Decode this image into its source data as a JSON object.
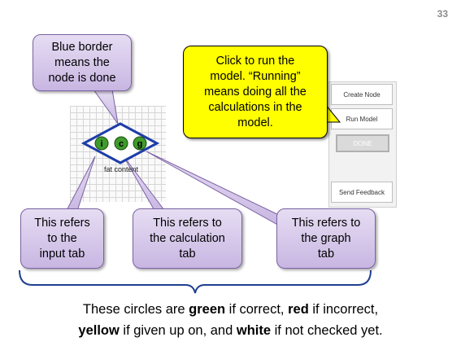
{
  "slide_number": "33",
  "node": {
    "label": "fat content",
    "badges": [
      "i",
      "c",
      "g"
    ],
    "border_color": "#1e3da8",
    "badge_color": "#3f9b2c"
  },
  "side_panel": {
    "create_node": "Create Node",
    "run_model": "Run Model",
    "done": "DONE",
    "send_feedback": "Send Feedback"
  },
  "callouts": {
    "blue_border": "Blue border\nmeans the\nnode is done",
    "run_model": "Click to run the\nmodel.  “Running”\nmeans doing all the\ncalculations in the\nmodel.",
    "input_tab": "This refers\nto the\ninput tab",
    "calc_tab": "This refers to\nthe calculation\ntab",
    "graph_tab": "This refers to\nthe graph\ntab"
  },
  "summary": {
    "line1": {
      "t1": "These circles are ",
      "green": "green",
      "t2": " if correct, ",
      "red": "red",
      "t3": " if incorrect,"
    },
    "line2": {
      "yellow": "yellow",
      "t1": " if given up on, and ",
      "white": "white",
      "t2": " if not checked yet."
    }
  },
  "colors": {
    "callout_fill": "#d9cdee",
    "callout_border": "#7b62a3",
    "yellow_callout": "#ffff00"
  }
}
